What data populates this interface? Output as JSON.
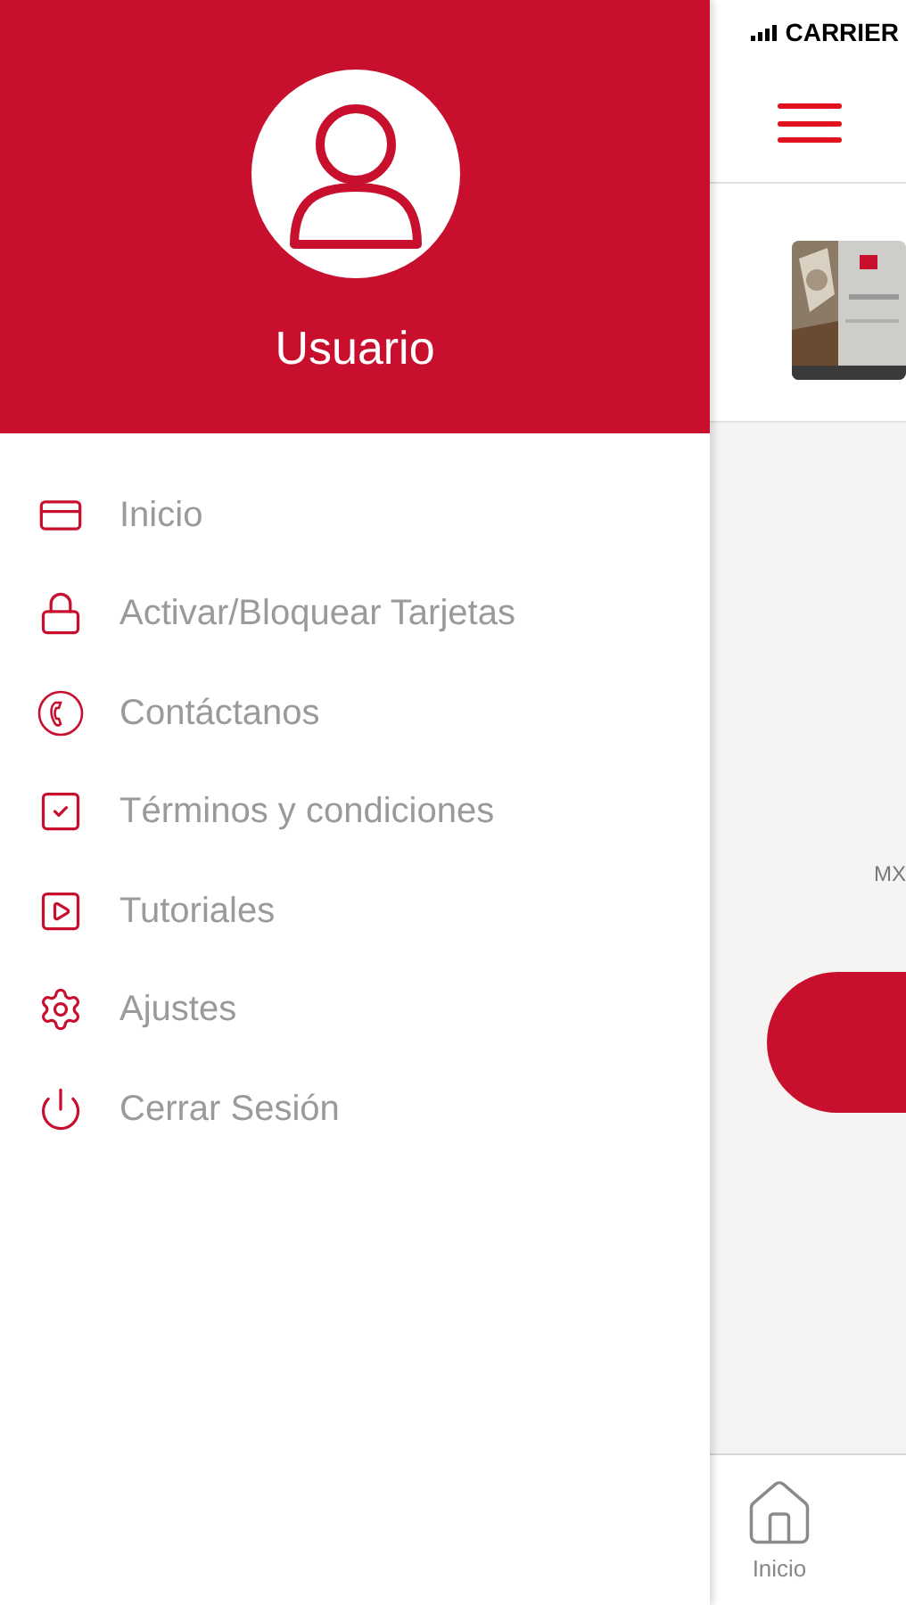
{
  "drawer": {
    "user_name": "Usuario",
    "menu": [
      {
        "label": "Inicio",
        "kind": "card"
      },
      {
        "label": "Activar/Bloquear Tarjetas",
        "kind": "lock"
      },
      {
        "label": "Contáctanos",
        "kind": "phone"
      },
      {
        "label": "Términos y condiciones",
        "kind": "check"
      },
      {
        "label": "Tutoriales",
        "kind": "play"
      },
      {
        "label": "Ajustes",
        "kind": "gear"
      },
      {
        "label": "Cerrar Sesión",
        "kind": "power"
      }
    ]
  },
  "status_bar": {
    "carrier": "CARRIER"
  },
  "background": {
    "currency": "MX",
    "bottom_nav": [
      {
        "label": "Inicio"
      }
    ]
  }
}
